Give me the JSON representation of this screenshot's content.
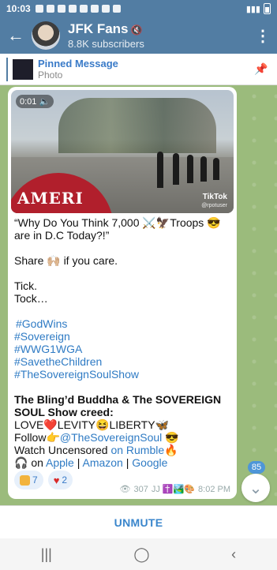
{
  "status_bar": {
    "time": "10:03"
  },
  "header": {
    "title": "JFK Fans",
    "subscribers": "8.8K subscribers"
  },
  "pinned": {
    "title": "Pinned Message",
    "subtitle": "Photo"
  },
  "video": {
    "duration": "0:01",
    "watermark": "TikTok",
    "watermark_user": "@rpotuser",
    "hat_text": "AMERI"
  },
  "message": {
    "line1": "“Why Do You Think 7,000 ⚔️🦅Troops 😎 are in D.C Today?!”",
    "share": "Share 🙌🏼 if you care.",
    "tick": "Tick.",
    "tock": "Tock…",
    "hashtags": [
      "#GodWins",
      "#Sovereign",
      "#WWG1WGA",
      "#SavetheChildren",
      "#TheSovereignSoulShow"
    ],
    "creed_title": "The Bling’d Buddha & The SOVEREIGN SOUL Show creed:",
    "creed_line": "LOVE❤️LEVITY😆LIBERTY🦋",
    "follow_prefix": "Follow👉",
    "follow_handle": "@TheSovereignSoul",
    "follow_suffix": " 😎",
    "watch_prefix": "Watch Uncensored ",
    "watch_link": "on Rumble",
    "watch_suffix": "🔥",
    "listen_prefix": "🎧 on ",
    "listen_apple": "Apple",
    "sep": " | ",
    "listen_amazon": "Amazon",
    "listen_google": "Google"
  },
  "reactions": [
    {
      "count": "7"
    },
    {
      "count": "2"
    }
  ],
  "meta": {
    "views": "307",
    "author": "JJ ✝️🏞️🎨",
    "time": "8:02 PM"
  },
  "unread_badge": "85",
  "bottom_bar": {
    "unmute": "UNMUTE"
  },
  "colors": {
    "header": "#527da3",
    "link": "#2f7bc4",
    "accent": "#3a86cc"
  }
}
